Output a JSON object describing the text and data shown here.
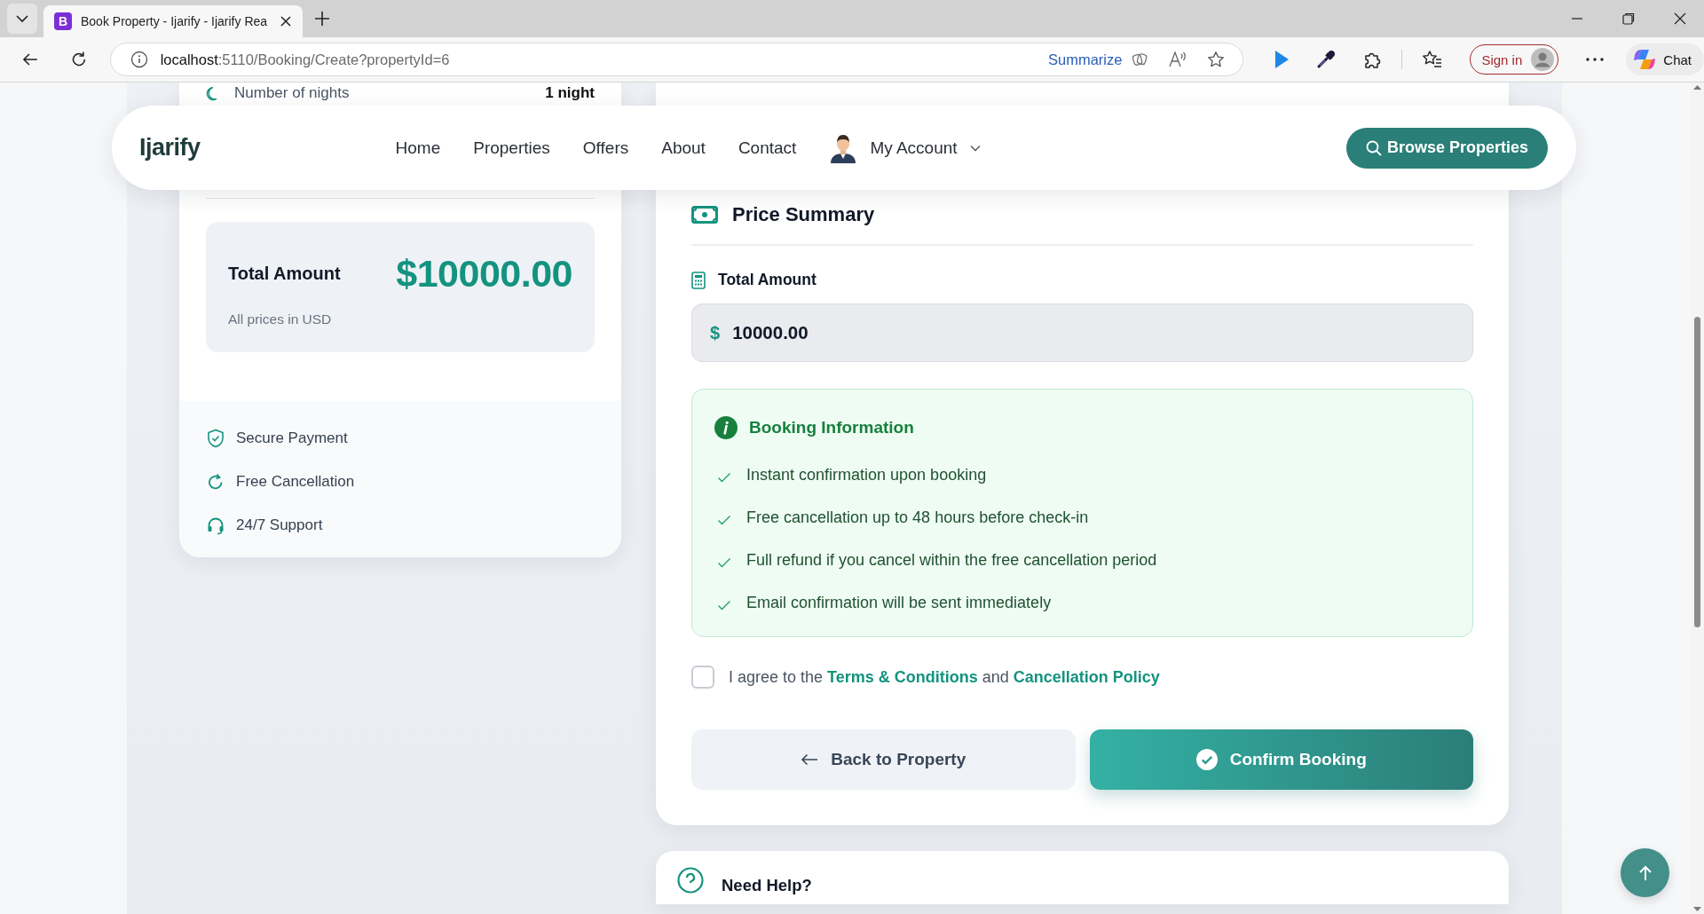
{
  "browser": {
    "favicon": "B",
    "tab_title": "Book Property - Ijarify - Ijarify Rea",
    "address_host": "localhost",
    "address_rest": ":5110/Booking/Create?propertyId=6",
    "summarize": "Summarize",
    "sign_in": "Sign in",
    "chat": "Chat"
  },
  "navbar": {
    "logo": "Ijarify",
    "links": [
      {
        "label": "Home"
      },
      {
        "label": "Properties"
      },
      {
        "label": "Offers"
      },
      {
        "label": "About"
      },
      {
        "label": "Contact"
      }
    ],
    "account": "My Account",
    "browse_button": "Browse Properties"
  },
  "summary_card": {
    "nights_label": "Number of nights",
    "nights_value": "1 night",
    "total_label": "Total Amount",
    "total_value": "$10000.00",
    "total_note": "All prices in USD",
    "features": [
      {
        "kind": "shield",
        "label": "Secure Payment"
      },
      {
        "kind": "refresh",
        "label": "Free Cancellation"
      },
      {
        "kind": "headset",
        "label": "24/7 Support"
      }
    ]
  },
  "price_summary": {
    "title": "Price Summary",
    "total_label": "Total Amount",
    "currency": "$",
    "total_value": "10000.00",
    "info": {
      "title": "Booking Information",
      "items": [
        "Instant confirmation upon booking",
        "Free cancellation up to 48 hours before check-in",
        "Full refund if you cancel within the free cancellation period",
        "Email confirmation will be sent immediately"
      ]
    },
    "agreement": {
      "checked": false,
      "text_before": "I agree to the",
      "terms_link": "Terms & Conditions",
      "text_middle": "and",
      "policy_link": "Cancellation Policy"
    },
    "back_button": "Back to Property",
    "confirm_button": "Confirm Booking"
  },
  "help_card": {
    "title": "Need Help?"
  }
}
